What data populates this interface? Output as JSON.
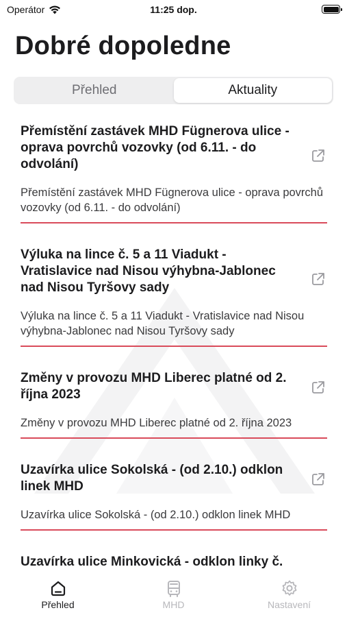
{
  "status": {
    "carrier": "Operátor",
    "time": "11:25 dop."
  },
  "header": {
    "title": "Dobré dopoledne"
  },
  "segments": [
    {
      "label": "Přehled",
      "active": false
    },
    {
      "label": "Aktuality",
      "active": true
    }
  ],
  "news": [
    {
      "title": "Přemístění zastávek MHD Fügnerova ulice - oprava povrchů vozovky (od 6.11. - do odvolání)",
      "description": "Přemístění zastávek MHD Fügnerova ulice - oprava povrchů vozovky (od 6.11. - do odvolání)",
      "icon": "external-link-icon"
    },
    {
      "title": "Výluka na lince č. 5 a 11 Viadukt - Vratislavice nad Nisou výhybna-Jablonec nad Nisou Tyršovy sady",
      "description": "Výluka na lince č. 5 a 11 Viadukt - Vratislavice nad Nisou výhybna-Jablonec nad Nisou Tyršovy sady",
      "icon": "external-link-icon"
    },
    {
      "title": "Změny v provozu MHD Liberec platné od 2. října 2023",
      "description": "Změny v provozu MHD Liberec platné od 2. října 2023",
      "icon": "external-link-icon"
    },
    {
      "title": "Uzavírka ulice Sokolská - (od 2.10.) odklon linek MHD",
      "description": "Uzavírka ulice Sokolská - (od 2.10.) odklon linek MHD",
      "icon": "external-link-icon"
    },
    {
      "title": "Uzavírka ulice Minkovická - odklon linky č.",
      "description": "",
      "icon": "external-link-icon"
    }
  ],
  "tabbar": [
    {
      "label": "Přehled",
      "icon": "home-icon",
      "active": true
    },
    {
      "label": "MHD",
      "icon": "bus-icon",
      "active": false
    },
    {
      "label": "Nastavení",
      "icon": "gear-icon",
      "active": false
    }
  ],
  "colors": {
    "accent": "#d94a5a",
    "inactive": "#b7b7bb"
  }
}
